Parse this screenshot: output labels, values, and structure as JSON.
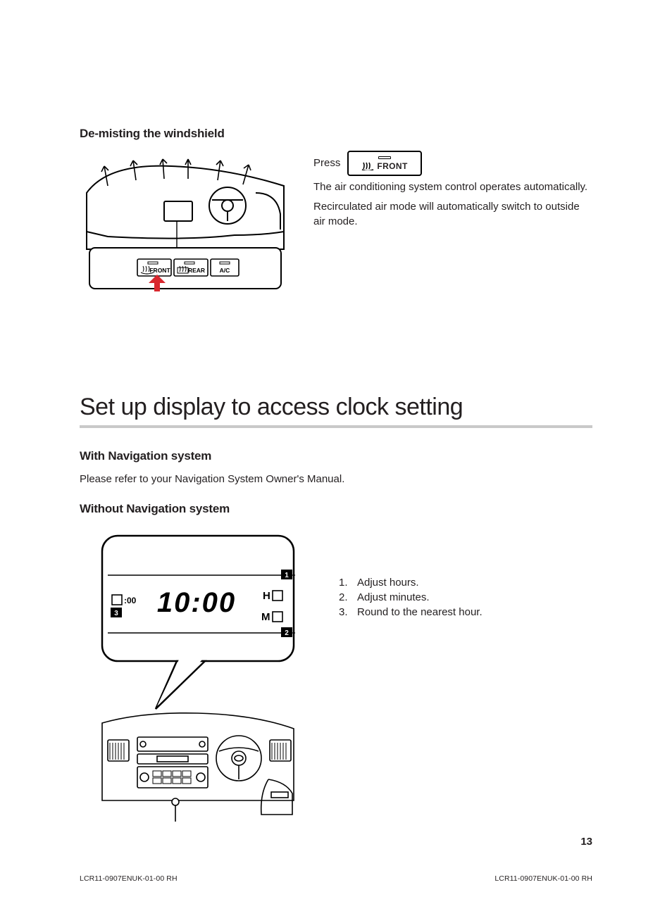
{
  "section1": {
    "heading": "De-misting the windshield",
    "press": "Press",
    "button_label": "FRONT",
    "buttons_inline": {
      "front": "FRONT",
      "rear": "REAR",
      "ac": "A/C"
    },
    "para1": "The air conditioning system control operates automatically.",
    "para2": "Recirculated air mode will automatically switch to outside air mode."
  },
  "section2": {
    "title": "Set up display to access clock setting",
    "with_nav_heading": "With Navigation system",
    "with_nav_text": "Please refer to your Navigation System Owner's Manual.",
    "without_nav_heading": "Without Navigation system",
    "clock_display": "10:00",
    "clock_small": ":00",
    "labels": {
      "h": "H",
      "m": "M"
    },
    "callouts": {
      "c1": "1",
      "c2": "2",
      "c3": "3"
    },
    "steps": [
      {
        "n": "1.",
        "t": "Adjust hours."
      },
      {
        "n": "2.",
        "t": "Adjust minutes."
      },
      {
        "n": "3.",
        "t": "Round to the nearest hour."
      }
    ]
  },
  "page_number": "13",
  "footer_code": "LCR11-0907ENUK-01-00 RH"
}
